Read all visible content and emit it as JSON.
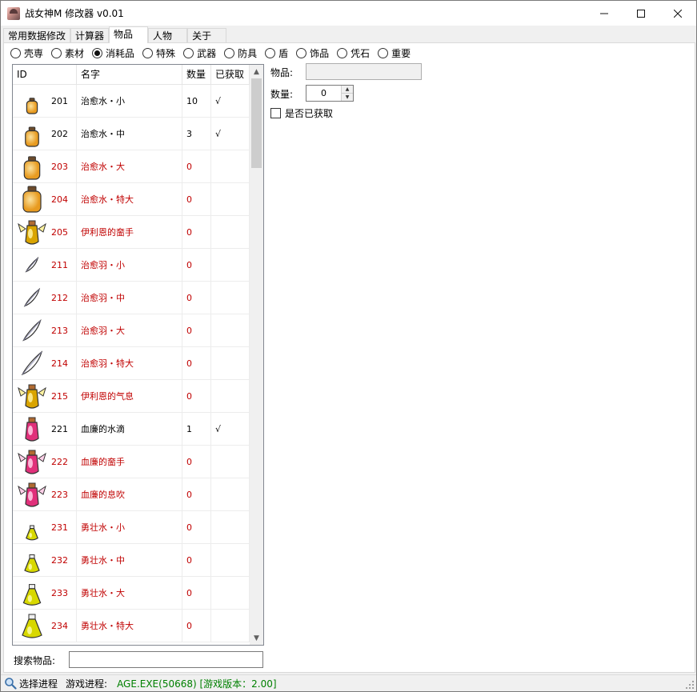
{
  "window": {
    "title": "战女神M 修改器 v0.01",
    "controls": {
      "minimize": "—",
      "maximize": "☐",
      "close": "✕"
    }
  },
  "tabs": [
    "常用数据修改",
    "计算器",
    "物品",
    "人物",
    "关于"
  ],
  "active_tab": "物品",
  "categories": [
    {
      "label": "壳専",
      "selected": false
    },
    {
      "label": "素材",
      "selected": false
    },
    {
      "label": "消耗品",
      "selected": true
    },
    {
      "label": "特殊",
      "selected": false
    },
    {
      "label": "武器",
      "selected": false
    },
    {
      "label": "防具",
      "selected": false
    },
    {
      "label": "盾",
      "selected": false
    },
    {
      "label": "饰品",
      "selected": false
    },
    {
      "label": "凭石",
      "selected": false
    },
    {
      "label": "重要",
      "selected": false
    }
  ],
  "list": {
    "headers": {
      "id": "ID",
      "name": "名字",
      "qty": "数量",
      "acquired": "已获取"
    },
    "colors": {
      "missing": "#c00000",
      "owned": "#000000"
    },
    "rows": [
      {
        "id": "201",
        "name": "治愈水・小",
        "qty": "10",
        "acquired": "√",
        "icon": "potion-small-orange",
        "missing": false
      },
      {
        "id": "202",
        "name": "治愈水・中",
        "qty": "3",
        "acquired": "√",
        "icon": "potion-medium-orange",
        "missing": false
      },
      {
        "id": "203",
        "name": "治愈水・大",
        "qty": "0",
        "acquired": "",
        "icon": "potion-large-orange",
        "missing": true
      },
      {
        "id": "204",
        "name": "治愈水・特大",
        "qty": "0",
        "acquired": "",
        "icon": "potion-xl-orange",
        "missing": true
      },
      {
        "id": "205",
        "name": "伊利恩的奤手",
        "qty": "0",
        "acquired": "",
        "icon": "angel-vial-gold",
        "missing": true
      },
      {
        "id": "211",
        "name": "治愈羽・小",
        "qty": "0",
        "acquired": "",
        "icon": "feather-small",
        "missing": true
      },
      {
        "id": "212",
        "name": "治愈羽・中",
        "qty": "0",
        "acquired": "",
        "icon": "feather-medium",
        "missing": true
      },
      {
        "id": "213",
        "name": "治愈羽・大",
        "qty": "0",
        "acquired": "",
        "icon": "feather-large",
        "missing": true
      },
      {
        "id": "214",
        "name": "治愈羽・特大",
        "qty": "0",
        "acquired": "",
        "icon": "feather-xl",
        "missing": true
      },
      {
        "id": "215",
        "name": "伊利恩的气息",
        "qty": "0",
        "acquired": "",
        "icon": "winged-vial-gold",
        "missing": true
      },
      {
        "id": "221",
        "name": "血廉的水滴",
        "qty": "1",
        "acquired": "√",
        "icon": "vial-pink",
        "missing": false
      },
      {
        "id": "222",
        "name": "血廉的奤手",
        "qty": "0",
        "acquired": "",
        "icon": "crowned-vial-pink",
        "missing": true
      },
      {
        "id": "223",
        "name": "血廉的息吹",
        "qty": "0",
        "acquired": "",
        "icon": "winged-vial-pink",
        "missing": true
      },
      {
        "id": "231",
        "name": "勇壮水・小",
        "qty": "0",
        "acquired": "",
        "icon": "flask-small-yellow",
        "missing": true
      },
      {
        "id": "232",
        "name": "勇壮水・中",
        "qty": "0",
        "acquired": "",
        "icon": "flask-medium-yellow",
        "missing": true
      },
      {
        "id": "233",
        "name": "勇壮水・大",
        "qty": "0",
        "acquired": "",
        "icon": "flask-large-yellow",
        "missing": true
      },
      {
        "id": "234",
        "name": "勇壮水・特大",
        "qty": "0",
        "acquired": "",
        "icon": "flask-xl-yellow",
        "missing": true
      }
    ]
  },
  "search": {
    "label": "搜索物品:",
    "value": ""
  },
  "detail": {
    "item_label": "物品:",
    "item_value": "",
    "qty_label": "数量:",
    "qty_value": "0",
    "acquired_label": "是否已获取",
    "acquired_checked": false
  },
  "status": {
    "select_process": "选择进程",
    "process_label": "游戏进程:",
    "process_value": "AGE.EXE(50668) [游戏版本：2.00]"
  }
}
